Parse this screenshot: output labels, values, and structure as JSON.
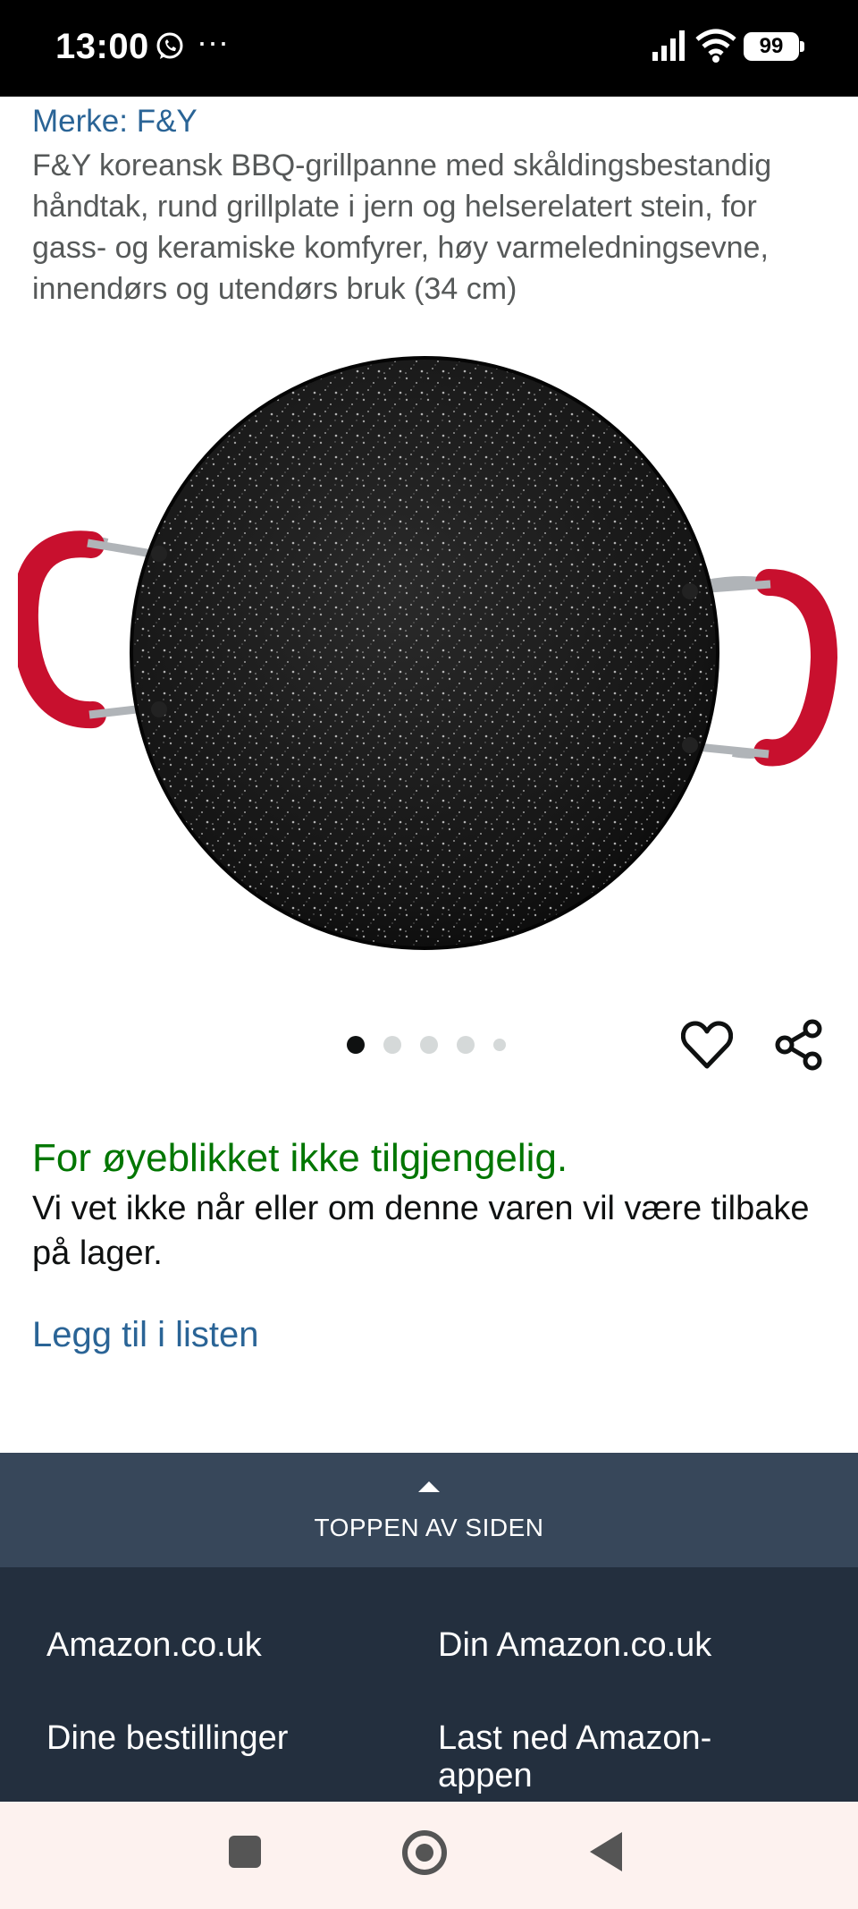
{
  "status_bar": {
    "time": "13:00",
    "dots": "···",
    "battery": "99",
    "icons": [
      "whatsapp-icon",
      "signal-icon",
      "wifi-icon",
      "battery-icon"
    ]
  },
  "product": {
    "brand": "Merke: F&Y",
    "title": "F&Y koreansk BBQ-grillpanne med skåldingsbestandig håndtak, rund grillplate i jern og helserelatert stein, for gass- og keramiske komfyrer, høy varmeledningsevne, innendørs og utendørs bruk (34 cm)"
  },
  "carousel": {
    "image_count": 5,
    "active_index": 0
  },
  "availability": {
    "status": "For øyeblikket ikke tilgjengelig.",
    "note": "Vi vet ikke når eller om denne varen vil være tilbake på lager.",
    "add_to_list": "Legg til i listen"
  },
  "back_to_top": {
    "label": "TOPPEN AV SIDEN"
  },
  "footer": {
    "links": [
      "Amazon.co.uk",
      "Din Amazon.co.uk",
      "Dine bestillinger",
      "Last ned Amazon-appen"
    ]
  },
  "colors": {
    "link": "#2a6496",
    "available_status": "#007600",
    "back_to_top_bg": "#37475a",
    "footer_bg": "#232f3e",
    "handle_red": "#c8102e"
  }
}
